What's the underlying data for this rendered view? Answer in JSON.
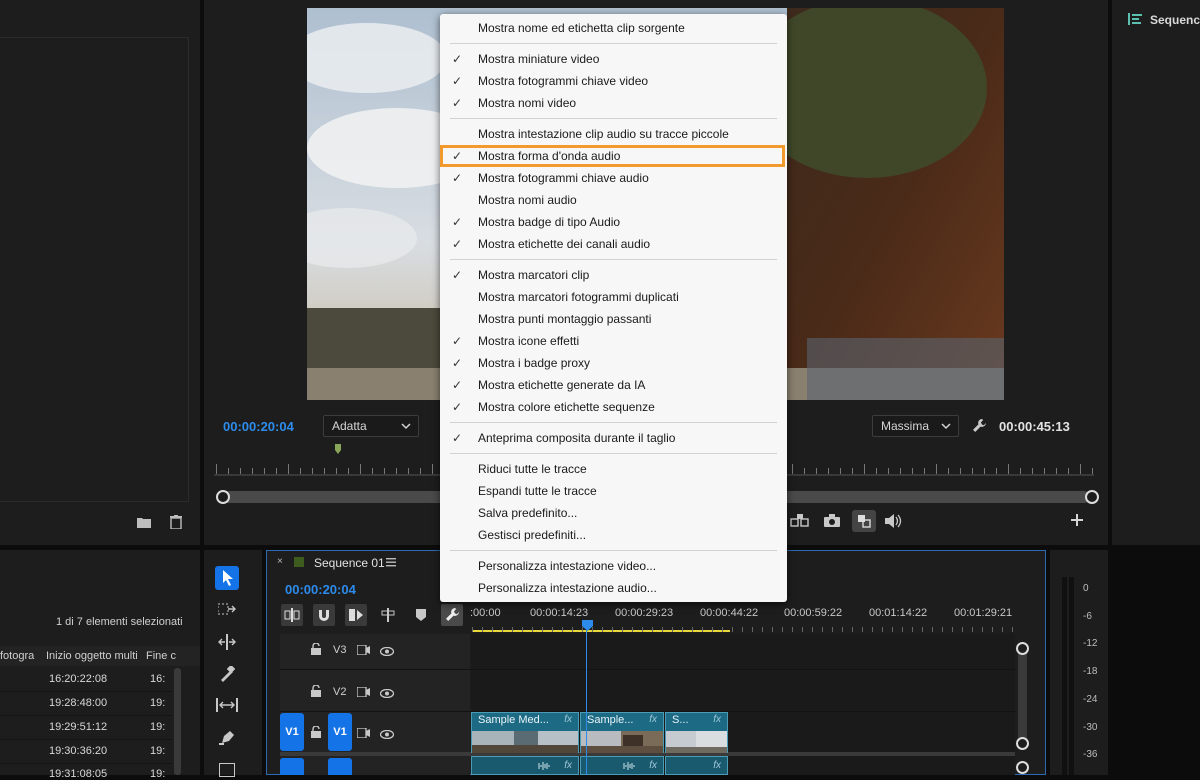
{
  "project_panel": {
    "selection_count": "1 di 7 elementi selezionati",
    "columns": [
      "fotogra",
      "Inizio oggetto multi",
      "Fine c"
    ],
    "rows": [
      {
        "start": "16:20:22:08",
        "end": "16:"
      },
      {
        "start": "19:28:48:00",
        "end": "19:"
      },
      {
        "start": "19:29:51:12",
        "end": "19:"
      },
      {
        "start": "19:30:36:20",
        "end": "19:"
      },
      {
        "start": "19:31:08:05",
        "end": "19:"
      }
    ]
  },
  "program_monitor": {
    "timecode_current": "00:00:20:04",
    "fit_dropdown": "Adatta",
    "quality_dropdown": "Massima",
    "timecode_duration": "00:00:45:13"
  },
  "right_panel": {
    "tab_label": "Sequence"
  },
  "context_menu": {
    "items": [
      {
        "label": "Mostra nome ed etichetta clip sorgente",
        "checked": false
      },
      {
        "label": "Mostra miniature video",
        "checked": true
      },
      {
        "label": "Mostra fotogrammi chiave video",
        "checked": true
      },
      {
        "label": "Mostra nomi video",
        "checked": true
      },
      {
        "label": "Mostra intestazione clip audio su tracce piccole",
        "checked": false
      },
      {
        "label": "Mostra forma d'onda audio",
        "checked": true
      },
      {
        "label": "Mostra fotogrammi chiave audio",
        "checked": true
      },
      {
        "label": "Mostra nomi audio",
        "checked": false
      },
      {
        "label": "Mostra badge di tipo Audio",
        "checked": true
      },
      {
        "label": "Mostra etichette dei canali audio",
        "checked": true
      },
      {
        "label": "Mostra marcatori clip",
        "checked": true
      },
      {
        "label": "Mostra marcatori fotogrammi duplicati",
        "checked": false
      },
      {
        "label": "Mostra punti montaggio passanti",
        "checked": false
      },
      {
        "label": "Mostra icone effetti",
        "checked": true
      },
      {
        "label": "Mostra i badge proxy",
        "checked": true
      },
      {
        "label": "Mostra etichette generate da IA",
        "checked": true
      },
      {
        "label": "Mostra colore etichette sequenze",
        "checked": true
      },
      {
        "label": "Anteprima composita durante il taglio",
        "checked": true
      },
      {
        "label": "Riduci tutte le tracce",
        "checked": false
      },
      {
        "label": "Espandi tutte le tracce",
        "checked": false
      },
      {
        "label": "Salva predefinito...",
        "checked": false
      },
      {
        "label": "Gestisci predefiniti...",
        "checked": false
      },
      {
        "label": "Personalizza intestazione video...",
        "checked": false
      },
      {
        "label": "Personalizza intestazione audio...",
        "checked": false
      }
    ],
    "highlighted_item": "Mostra forma d'onda audio",
    "highlight_color": "#f29a2e",
    "check_glyph": "✓"
  },
  "timeline": {
    "sequence_name": "Sequence 01",
    "timecode": "00:00:20:04",
    "ruler_labels": [
      ":00:00",
      "00:00:14:23",
      "00:00:29:23",
      "00:00:44:22",
      "00:00:59:22",
      "00:01:14:22",
      "00:01:29:21"
    ],
    "tracks": [
      "V3",
      "V2",
      "V1"
    ],
    "source_patch": "V1",
    "clips": [
      {
        "name": "Sample Med...",
        "fx": "fx"
      },
      {
        "name": "Sample...",
        "fx": "fx"
      },
      {
        "name": "S...",
        "fx": "fx"
      }
    ]
  },
  "audio_meter": {
    "db_labels": [
      "0",
      "-6",
      "-12",
      "-18",
      "-24",
      "-30",
      "-36"
    ]
  },
  "accent_color": "#2d8ceb"
}
